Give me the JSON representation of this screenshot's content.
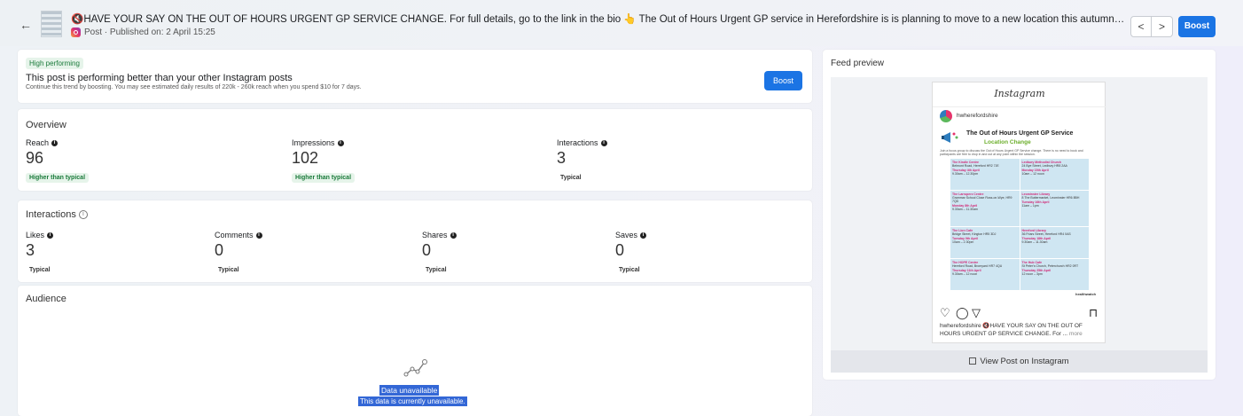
{
  "header": {
    "back_icon": "arrow-left-icon",
    "post_title": "🔇HAVE YOUR SAY ON THE OUT OF HOURS URGENT GP SERVICE CHANGE. For full details, go to the link in the bio 👆 The Out of Hours Urgent GP service in Herefordshire is is planning to move to a new location this autumn. The service is only available f...",
    "post_meta": "Post · Published on: 2 April 15:25",
    "prev_label": "<",
    "next_label": ">",
    "boost_label": "Boost"
  },
  "performance": {
    "badge": "High performing",
    "title": "This post is performing better than your other Instagram posts",
    "text": "Continue this trend by boosting. You may see estimated daily results of 220k - 260k reach when you spend $10 for 7 days.",
    "boost_label": "Boost"
  },
  "overview": {
    "title": "Overview",
    "metrics": [
      {
        "label": "Reach",
        "value": "96",
        "note": "Higher than typical"
      },
      {
        "label": "Impressions",
        "value": "102",
        "note": "Higher than typical"
      },
      {
        "label": "Interactions",
        "value": "3",
        "note": "Typical"
      }
    ]
  },
  "interactions": {
    "title": "Interactions",
    "metrics": [
      {
        "label": "Likes",
        "value": "3",
        "note": "Typical"
      },
      {
        "label": "Comments",
        "value": "0",
        "note": "Typical"
      },
      {
        "label": "Shares",
        "value": "0",
        "note": "Typical"
      },
      {
        "label": "Saves",
        "value": "0",
        "note": "Typical"
      }
    ]
  },
  "audience": {
    "title": "Audience",
    "unavailable_title": "Data unavailable",
    "unavailable_text": "This data is currently unavailable."
  },
  "feed": {
    "title": "Feed preview",
    "ig_logo": "Instagram",
    "username": "hwherefordshire",
    "poster_heading": "The Out of Hours Urgent GP Service",
    "poster_subheading": "Location Change",
    "poster_intro": "Join a focus group to discuss the Out of Hours Urgent GP Service change. There is no need to book and participants are free to drop in and out at any point within the session.",
    "venues": [
      {
        "name": "The Kindle Centre",
        "address": "Belmont Road, Hereford HR2 7JE",
        "date": "Thursday 4th April",
        "time": "9.30am – 12.30pm"
      },
      {
        "name": "Ledbury Methodist Church",
        "address": "24 Bye Street, Ledbury HR8 2AA",
        "date": "Monday 15th April",
        "time": "10am – 12 noon"
      },
      {
        "name": "The Larruperz Centre",
        "address": "Grammar School Close Ross-on-Wye, HR9 7QD",
        "date": "Monday 8th April",
        "time": "9.30am – 11.30am"
      },
      {
        "name": "Leominster Library",
        "address": "8 The Buttermarket, Leominster HR6 8BH",
        "date": "Tuesday 16th April",
        "time": "11am – 1pm"
      },
      {
        "name": "The Lion Cafe",
        "address": "Bridge Street, Kington HR5 3DJ",
        "date": "Tuesday 9th April",
        "time": "10am – 2.30pm"
      },
      {
        "name": "Hereford Library",
        "address": "36 Friars Street, Hereford HR4 0AS",
        "date": "Thursday 18th April",
        "time": "9.30am – 11.30am"
      },
      {
        "name": "The HOPE Centre",
        "address": "Hereford Road, Bromyard HR7 4QU",
        "date": "Thursday 11th April",
        "time": "9.30am – 12 noon"
      },
      {
        "name": "The Hub Cafe",
        "address": "St Peter's Church, Peterchurch HR2 0RT",
        "date": "Thursday 25th April",
        "time": "12 noon – 3pm"
      }
    ],
    "hw_logo": "healthwatch",
    "caption_user": "hwherefordshire",
    "caption_text": "🔇HAVE YOUR SAY ON THE OUT OF HOURS URGENT GP SERVICE CHANGE. For ...",
    "caption_more": "more",
    "view_label": "View Post on Instagram"
  }
}
